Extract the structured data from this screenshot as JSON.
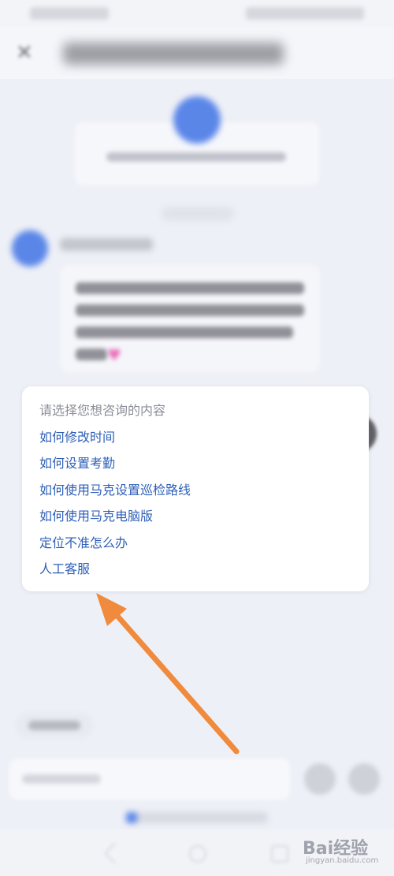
{
  "options_panel": {
    "title": "请选择您想咨询的内容",
    "options": [
      "如何修改时间",
      "如何设置考勤",
      "如何使用马克设置巡检路线",
      "如何使用马克电脑版",
      "定位不准怎么办",
      "人工客服"
    ]
  },
  "watermark": {
    "brand": "Bai经验",
    "url": "jingyan.baidu.com"
  },
  "colors": {
    "background": "#eef0f7",
    "card": "#ffffff",
    "option_text": "#2e5fb8",
    "title_text": "#8c8e98",
    "arrow": "#f08a3c",
    "avatar": "#5a86e8"
  },
  "icons": [
    "close-icon",
    "heart-icon",
    "emoji-icon",
    "plus-icon",
    "back-icon",
    "home-icon",
    "recent-apps-icon"
  ]
}
